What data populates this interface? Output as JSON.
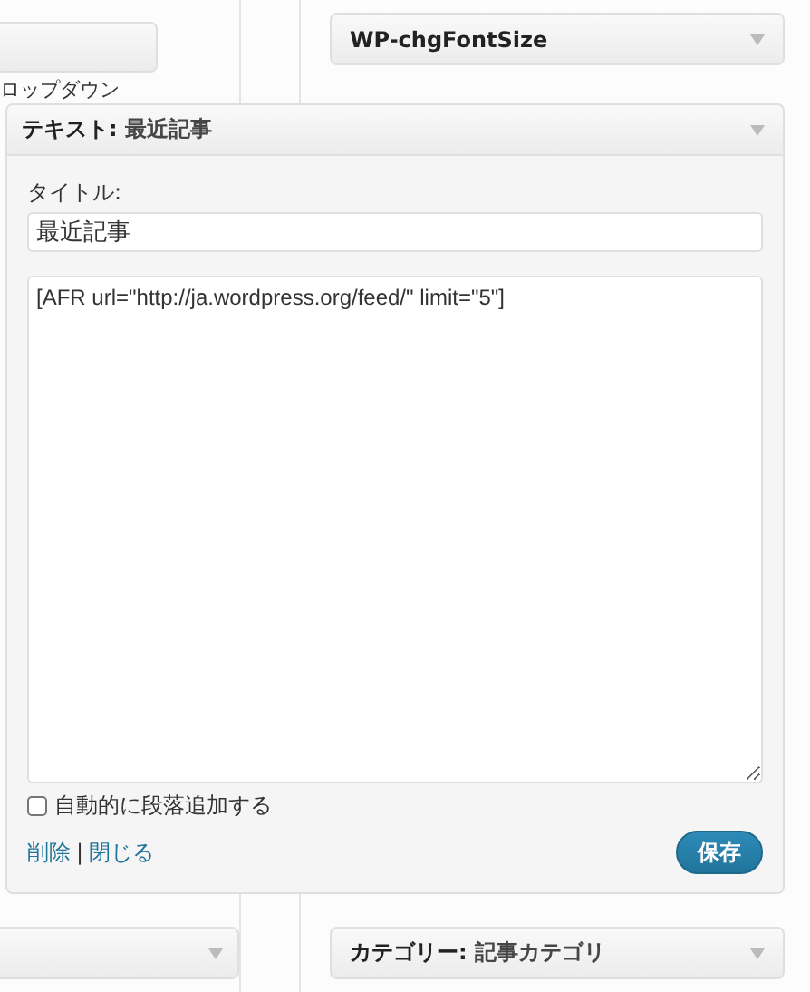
{
  "background": {
    "left_caption": "ロップダウン",
    "right_top_widget": {
      "title": "WP-chgFontSize"
    },
    "right_bottom_widget": {
      "label": "カテゴリー:",
      "name": "記事カテゴリ"
    }
  },
  "widget": {
    "label": "テキスト:",
    "name": "最近記事",
    "title_label": "タイトル:",
    "title_value": "最近記事",
    "content": "[AFR url=\"http://ja.wordpress.org/feed/\" limit=\"5\"]",
    "autop": {
      "label": "自動的に段落追加する",
      "checked": false
    },
    "links": [
      "削除",
      "閉じる"
    ],
    "separator": "|",
    "save": "保存"
  }
}
